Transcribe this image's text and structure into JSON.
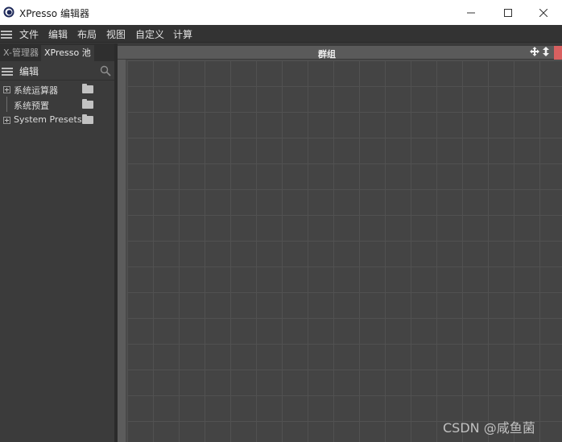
{
  "window": {
    "title": "XPresso 编辑器",
    "app_icon": "cinema4d-logo-icon",
    "controls": [
      "minimize-icon",
      "maximize-icon",
      "close-icon"
    ]
  },
  "menubar": {
    "menu_icon": "hamburger-icon",
    "items": [
      "文件",
      "编辑",
      "布局",
      "视图",
      "自定义",
      "计算"
    ]
  },
  "left_panel": {
    "tabs": [
      {
        "label": "X-管理器",
        "active": false
      },
      {
        "label": "XPresso 池",
        "active": true
      }
    ],
    "subbar": {
      "menu_icon": "hamburger-icon",
      "label": "编辑",
      "search_icon": "search-icon"
    },
    "tree": [
      {
        "label": "系统运算器",
        "expandable": true,
        "icon": "folder-icon"
      },
      {
        "label": "系统预置",
        "expandable": false,
        "icon": "folder-icon"
      },
      {
        "label": "System Presets",
        "expandable": true,
        "icon": "folder-icon"
      }
    ]
  },
  "editor": {
    "group_title": "群组",
    "header_icons": [
      "move-icon",
      "resize-icon"
    ],
    "colors": {
      "input_port": "#3f72c6",
      "output_port": "#d86060",
      "grid_bg": "#444444"
    }
  },
  "watermark": "CSDN @咸鱼菌"
}
